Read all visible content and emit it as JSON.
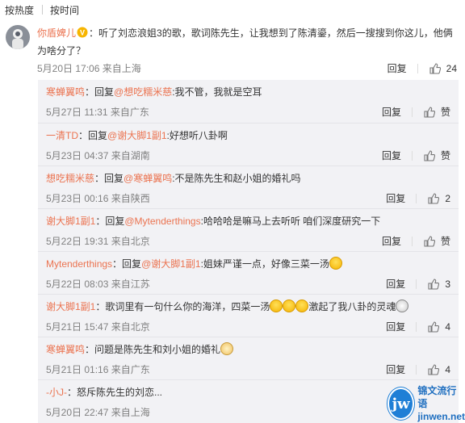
{
  "sort_tabs": [
    "按热度",
    "按时间"
  ],
  "main_comment": {
    "user": "你盾婢儿",
    "text": "：听了刘恋浪姐3的歌，歌词陈先生，让我想到了陈清鎏，然后一搜搜到你这儿，他俩为啥分了？",
    "time": "5月20日 17:06 来自上海",
    "reply_label": "回复",
    "likes": "24"
  },
  "replies": [
    {
      "user": "寒蝉翼鸣",
      "pre": "：回复",
      "target": "@想吃糯米慈",
      "text": ":我不管，我就是空耳",
      "time": "5月27日 11:31 来自广东",
      "reply_label": "回复",
      "likes": "赞"
    },
    {
      "user": "一清TD",
      "pre": "：回复",
      "target": "@谢大脚1副1",
      "text": ":好想听八卦啊",
      "time": "5月23日 04:37 来自湖南",
      "reply_label": "回复",
      "likes": "赞"
    },
    {
      "user": "想吃糯米慈",
      "pre": "：回复",
      "target": "@寒蝉翼鸣",
      "text": ":不是陈先生和赵小姐的婚礼吗",
      "time": "5月23日 00:16 来自陕西",
      "reply_label": "回复",
      "likes": "2"
    },
    {
      "user": "谢大脚1副1",
      "pre": "：回复",
      "target": "@Mytenderthings",
      "text": ":哈哈哈是嘛马上去听听 咱们深度研究一下",
      "time": "5月22日 19:31 来自北京",
      "reply_label": "回复",
      "likes": "赞"
    },
    {
      "user": "Mytenderthings",
      "pre": "：回复",
      "target": "@谢大脚1副1",
      "text": ":姐妹严谨一点，好像三菜一汤",
      "time": "5月22日 08:03 来自江苏",
      "reply_label": "回复",
      "likes": "3"
    },
    {
      "user": "谢大脚1副1",
      "pre": "：",
      "target": "",
      "text": "歌词里有一句什么你的海洋，四菜一汤",
      "text2": "激起了我八卦的灵魂",
      "time": "5月21日 15:47 来自北京",
      "reply_label": "回复",
      "likes": "4"
    },
    {
      "user": "寒蝉翼鸣",
      "pre": "：",
      "target": "",
      "text": "问题是陈先生和刘小姐的婚礼",
      "time": "5月21日 01:16 来自广东",
      "reply_label": "回复",
      "likes": "4"
    },
    {
      "user": "-小J-",
      "pre": "：",
      "target": "",
      "text": "怒斥陈先生的刘恋...",
      "time": "5月20日 22:47 来自上海",
      "reply_label": "",
      "likes": ""
    }
  ],
  "watermark": {
    "logo": "jw",
    "cn": "锦文流行语",
    "en": "jinwen.net"
  },
  "colors": {
    "link": "#eb7350",
    "panel_bg": "#f2f2f5",
    "time": "#808080"
  }
}
